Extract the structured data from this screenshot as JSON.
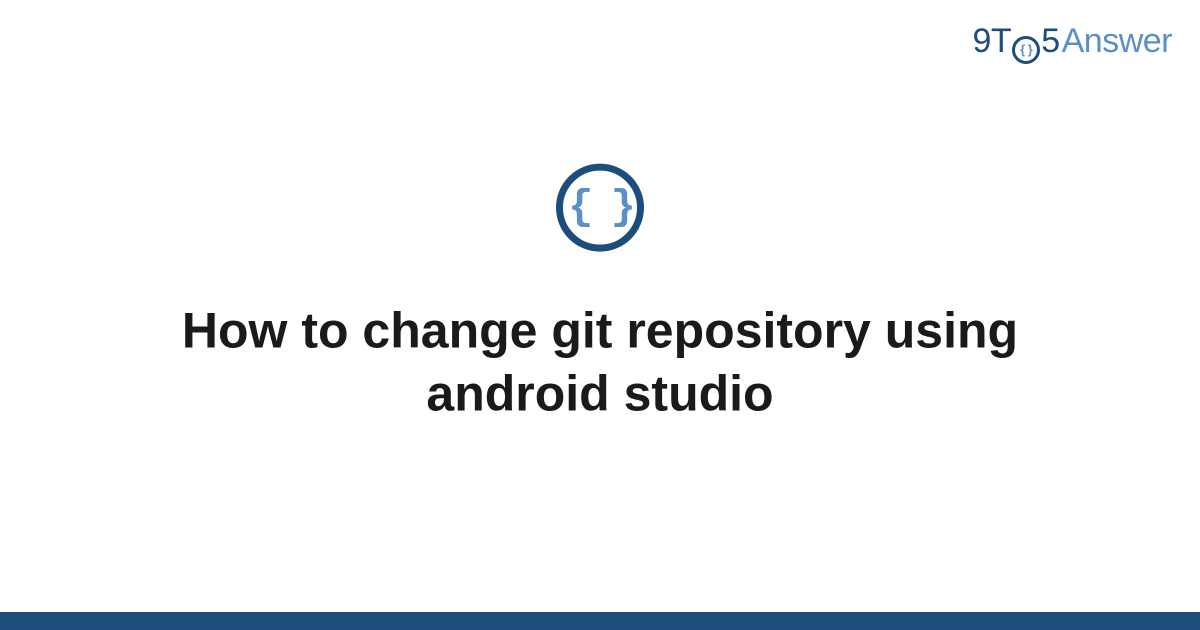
{
  "brand": {
    "part1": "9T",
    "part_o_inner": "{ }",
    "part2": "5",
    "part3": "Answer"
  },
  "icon": {
    "braces_glyph": "{ }",
    "semantic": "code-braces-icon"
  },
  "title": "How to change git repository using android studio",
  "colors": {
    "dark_blue": "#1d4d7a",
    "light_blue": "#5b8fc7",
    "text": "#1a1a1a",
    "bg": "#ffffff"
  }
}
